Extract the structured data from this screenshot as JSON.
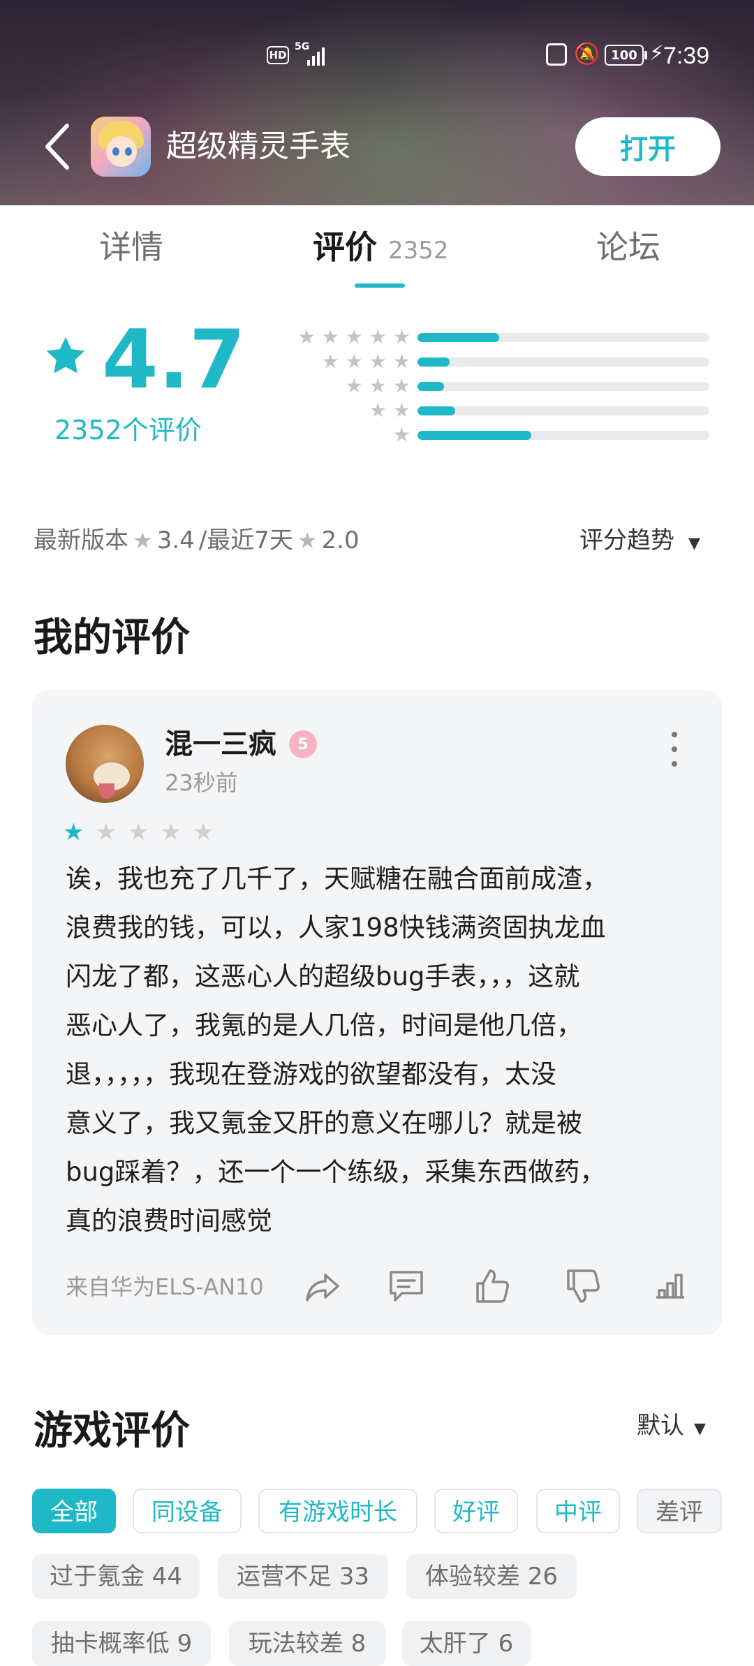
{
  "status_bar": {
    "hd": "HD",
    "network": "5G",
    "battery": "100",
    "time": "7:39"
  },
  "app": {
    "title": "超级精灵手表",
    "open_label": "打开"
  },
  "tabs": [
    {
      "label": "详情"
    },
    {
      "label": "评价",
      "count": "2352"
    },
    {
      "label": "论坛"
    }
  ],
  "rating": {
    "score": "4.7",
    "count_label": "2352个评价",
    "distribution": [
      {
        "stars": 5,
        "fraction": 0.28
      },
      {
        "stars": 4,
        "fraction": 0.11
      },
      {
        "stars": 3,
        "fraction": 0.09
      },
      {
        "stars": 2,
        "fraction": 0.13
      },
      {
        "stars": 1,
        "fraction": 0.39
      }
    ]
  },
  "version": {
    "latest_label": "最新版本",
    "latest_score": "3.4",
    "separator": "/最近7天",
    "recent_score": "2.0",
    "trend_label": "评分趋势"
  },
  "my_review": {
    "section_title": "我的评价",
    "user": "混一三疯",
    "level": "5",
    "time": "23秒前",
    "stars": 1,
    "text_lines": [
      "诶，我也充了几千了，天赋糖在融合面前成渣，",
      "浪费我的钱，可以，人家198快钱满资固执龙血",
      "闪龙了都，这恶心人的超级bug手表，，，这就",
      "恶心人了，我氪的是人几倍，时间是他几倍，",
      "退，，，，，我现在登游戏的欲望都没有，太没",
      "意义了，我又氪金又肝的意义在哪儿？就是被",
      "bug踩着？，还一个一个练级，采集东西做药，",
      "真的浪费时间感觉"
    ],
    "device": "来自华为ELS-AN10",
    "actions": [
      "share-icon",
      "comment-icon",
      "thumbs-up-icon",
      "thumbs-down-icon",
      "stats-icon"
    ]
  },
  "game_reviews": {
    "section_title": "游戏评价",
    "sort_label": "默认",
    "filters": [
      "全部",
      "同设备",
      "有游戏时长",
      "好评",
      "中评",
      "差评"
    ],
    "tags": [
      "过于氪金 44",
      "运营不足 33",
      "体验较差 26",
      "抽卡概率低 9",
      "玩法较差 8",
      "太肝了 6"
    ]
  },
  "colors": {
    "accent": "#1fb8c6",
    "card_bg": "#f4f5f7"
  }
}
